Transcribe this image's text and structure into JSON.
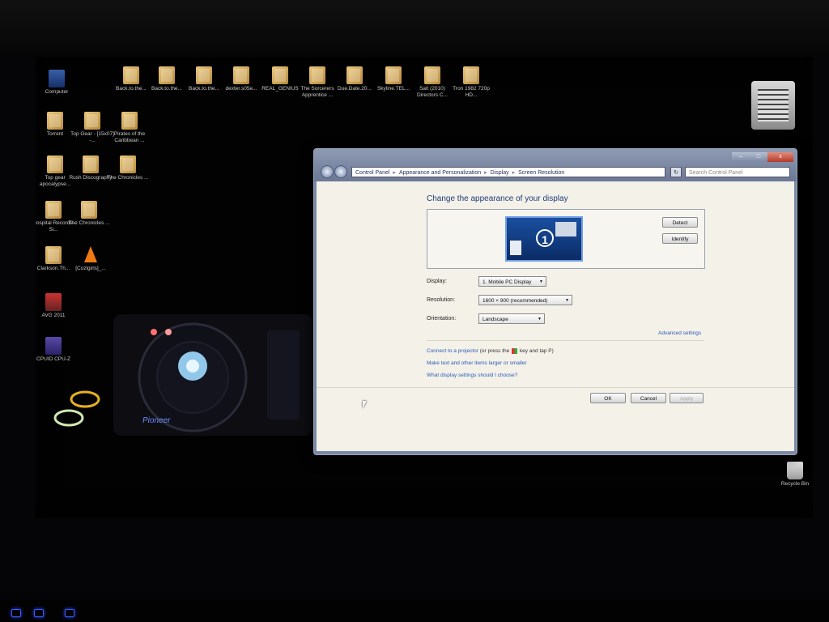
{
  "desktop": {
    "icons": [
      {
        "label": "Computer",
        "type": "pc"
      },
      {
        "label": "Back.to.the...",
        "type": "folder"
      },
      {
        "label": "Back.to.the...",
        "type": "folder"
      },
      {
        "label": "Back.to.the...",
        "type": "folder"
      },
      {
        "label": "dexter.s05e...",
        "type": "folder"
      },
      {
        "label": "REAL_GENIUS",
        "type": "folder"
      },
      {
        "label": "The Sorcerers Apprentice ...",
        "type": "folder"
      },
      {
        "label": "Due.Date.20...",
        "type": "folder"
      },
      {
        "label": "Skyline.TEL...",
        "type": "folder"
      },
      {
        "label": "Salt (2010) Directors C...",
        "type": "folder"
      },
      {
        "label": "Tron 1982 720p HD...",
        "type": "folder"
      },
      {
        "label": "Torrent",
        "type": "folder"
      },
      {
        "label": "Top Gear - [15x07] -...",
        "type": "folder"
      },
      {
        "label": "Pirates of the Caribbean ...",
        "type": "folder"
      },
      {
        "label": "Top gear apocalypse...",
        "type": "folder"
      },
      {
        "label": "Rush Discography",
        "type": "folder"
      },
      {
        "label": "The Chronicles ...",
        "type": "folder"
      },
      {
        "label": "Hospital Records-Si...",
        "type": "folder"
      },
      {
        "label": "The Chronicles ...",
        "type": "folder"
      },
      {
        "label": "Clarkson.Th...",
        "type": "folder"
      },
      {
        "label": "[Cozlgirls]_...",
        "type": "vlc"
      },
      {
        "label": "AVG 2011",
        "type": "app"
      },
      {
        "label": "CPUID CPU-Z",
        "type": "cpuz"
      },
      {
        "label": "Recycle Bin",
        "type": "recycle"
      }
    ],
    "wallpaper_brand": "Pioneer"
  },
  "window": {
    "breadcrumb": [
      "Control Panel",
      "Appearance and Personalization",
      "Display",
      "Screen Resolution"
    ],
    "search_placeholder": "Search Control Panel",
    "caption_min": "–",
    "caption_max": "□",
    "caption_close": "x",
    "heading": "Change the appearance of your display",
    "monitor_number": "1",
    "detect_label": "Detect",
    "identify_label": "Identify",
    "display_label": "Display:",
    "display_value": "1. Mobile PC Display",
    "resolution_label": "Resolution:",
    "resolution_value": "1600 × 900 (recommended)",
    "orientation_label": "Orientation:",
    "orientation_value": "Landscape",
    "advanced_link": "Advanced settings",
    "projector_link_a": "Connect to a projector",
    "projector_link_b": "(or press the",
    "projector_link_c": "key and tap P)",
    "text_size_link": "Make text and other items larger or smaller",
    "help_link": "What display settings should I choose?",
    "ok_label": "OK",
    "cancel_label": "Cancel",
    "apply_label": "Apply"
  }
}
